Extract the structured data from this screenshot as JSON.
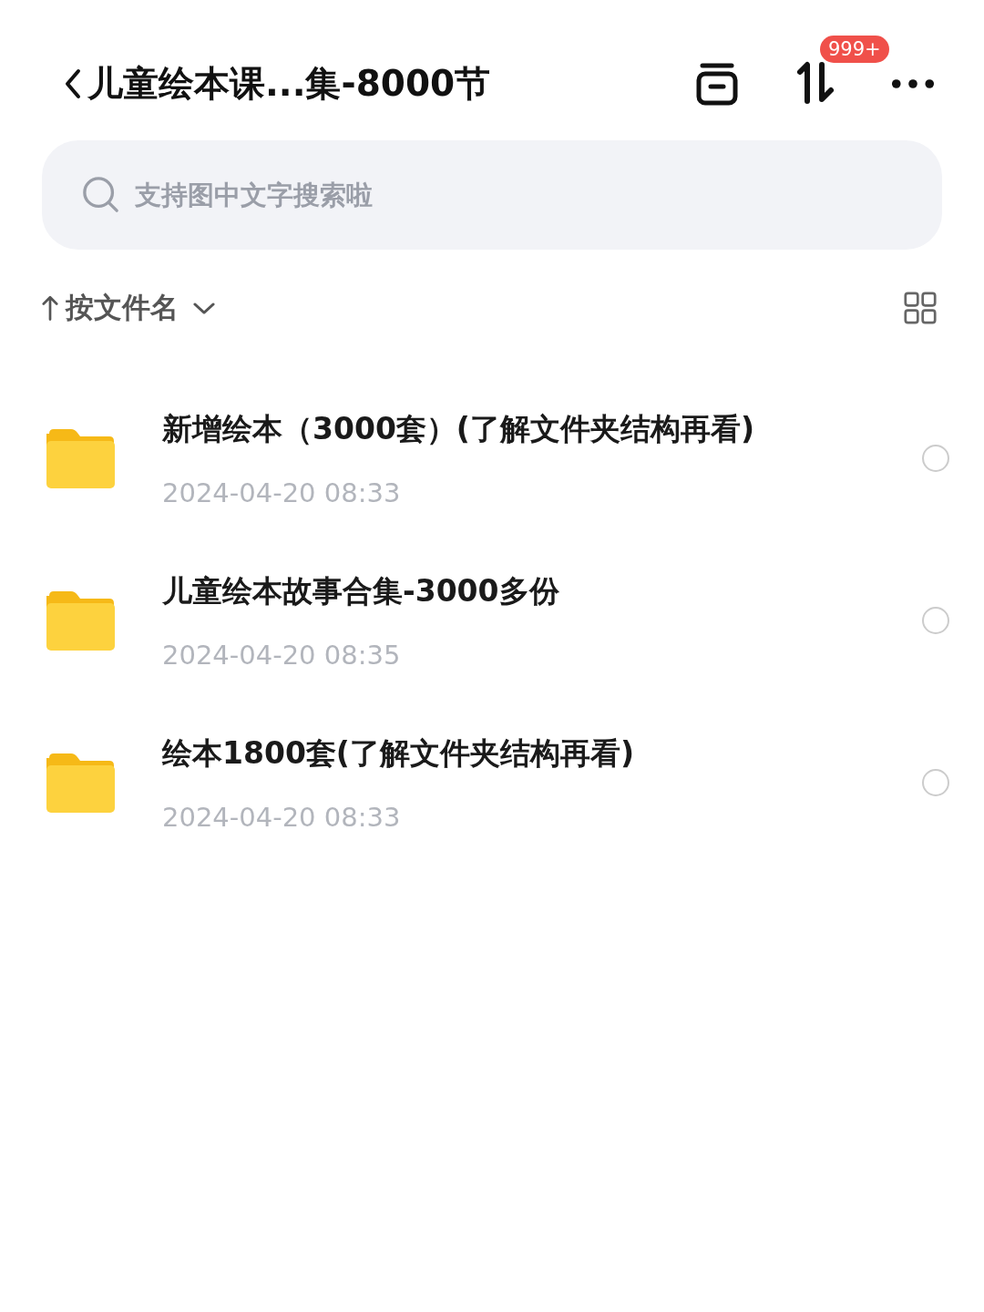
{
  "header": {
    "title": "儿童绘本课...集-8000节",
    "badge": "999+"
  },
  "search": {
    "placeholder": "支持图中文字搜索啦"
  },
  "sort": {
    "label": "按文件名"
  },
  "files": [
    {
      "name": "新增绘本（3000套）(了解文件夹结构再看)",
      "date": "2024-04-20 08:33",
      "selected": false
    },
    {
      "name": "儿童绘本故事合集-3000多份",
      "date": "2024-04-20 08:35",
      "selected": false
    },
    {
      "name": "绘本1800套(了解文件夹结构再看)",
      "date": "2024-04-20 08:33",
      "selected": false
    }
  ]
}
